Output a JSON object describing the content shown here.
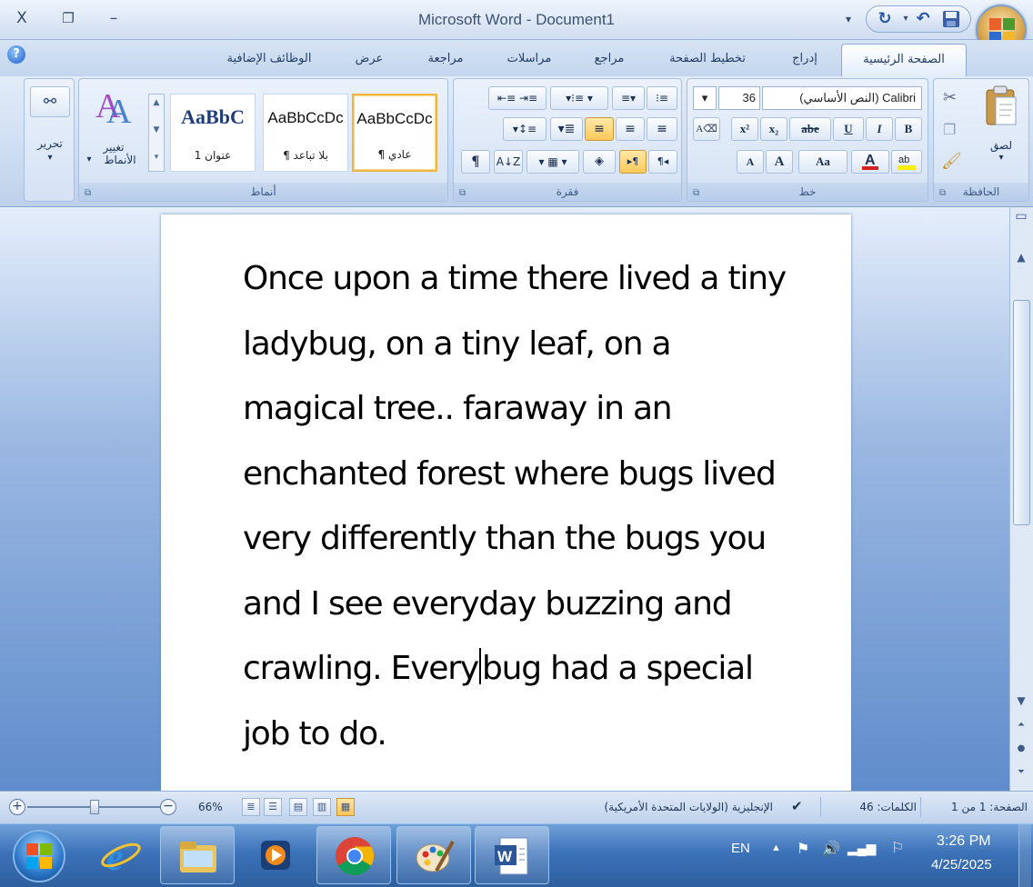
{
  "window": {
    "title": "Microsoft Word - Document1",
    "close_glyph": "X",
    "restore_glyph": "❐",
    "minimize_glyph": "–"
  },
  "quick_access": {
    "customize_glyph": "▾",
    "redo_glyph": "↻",
    "undo_glyph": "↶",
    "save_icon": "save-icon"
  },
  "tabs": [
    {
      "label": "الصفحة الرئيسية",
      "active": true
    },
    {
      "label": "إدراج"
    },
    {
      "label": "تخطيط الصفحة"
    },
    {
      "label": "مراجع"
    },
    {
      "label": "مراسلات"
    },
    {
      "label": "مراجعة"
    },
    {
      "label": "عرض"
    },
    {
      "label": "الوظائف الإضافية"
    }
  ],
  "ribbon": {
    "clipboard": {
      "label": "الحافظة",
      "paste_label": "لصق",
      "paste_arrow": "▾"
    },
    "font": {
      "label": "خط",
      "font_name": "(النص الأساسي) Calibri",
      "font_size": "36",
      "bold": "B",
      "italic": "I",
      "underline": "U",
      "strikethrough": "abe",
      "subscript": "x₂",
      "superscript": "x²",
      "change_case": "Aa",
      "grow": "A",
      "shrink": "A"
    },
    "paragraph": {
      "label": "فقرة",
      "pilcrow": "¶"
    },
    "styles": {
      "label": "أنماط",
      "cards": [
        {
          "sample": "AaBbCcDc",
          "name": "¶ عادي",
          "selected": true
        },
        {
          "sample": "AaBbCcDc",
          "name": "¶ بلا تباعد"
        },
        {
          "sample": "AaBbC",
          "name": "عنوان 1"
        }
      ],
      "change_styles_label_1": "تغيير",
      "change_styles_label_2": "الأنماط",
      "change_styles_arrow": "▾"
    },
    "editing": {
      "label": "تحرير",
      "arrow": "▾"
    }
  },
  "document": {
    "text_before_caret": "Once upon a time there lived a tiny ladybug, on a tiny leaf, on a magical tree.. faraway in an enchanted forest where bugs lived very differently than the bugs you and I see everyday buzzing and crawling. Every",
    "text_after_caret": "bug had a special job to do."
  },
  "status": {
    "page": "الصفحة: 1 من 1",
    "words": "الكلمات: 46",
    "language": "الإنجليزية (الولايات المتحدة الأمريكية)",
    "zoom": "66%",
    "zoom_level_percent": 66
  },
  "taskbar": {
    "apps": [
      "internet-explorer",
      "file-explorer",
      "media-player",
      "chrome",
      "paint",
      "word"
    ],
    "language": "EN",
    "time": "3:26 PM",
    "date": "4/25/2025"
  }
}
